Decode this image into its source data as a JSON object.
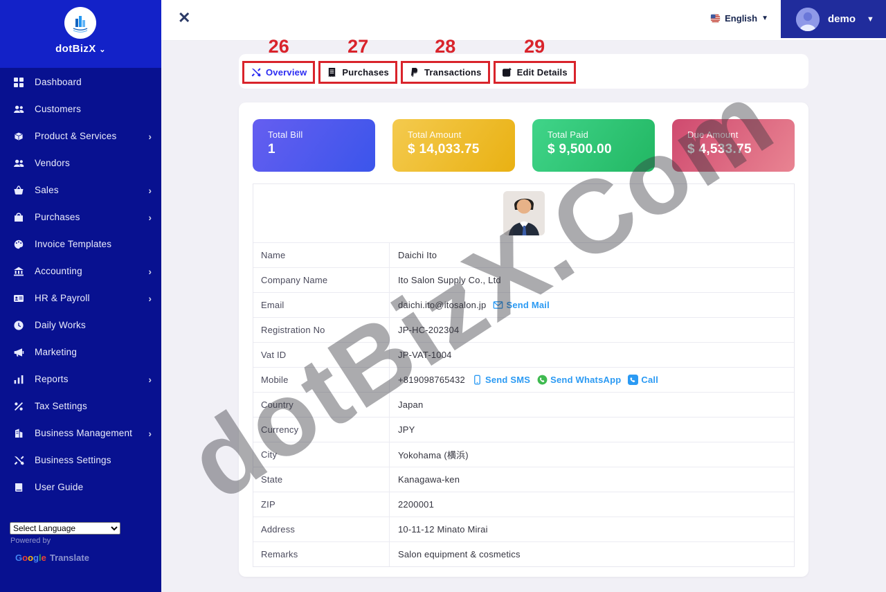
{
  "sidebar": {
    "brand": "dotBizX",
    "items": [
      {
        "label": "Dashboard",
        "icon": "grid",
        "expandable": false
      },
      {
        "label": "Customers",
        "icon": "users",
        "expandable": false
      },
      {
        "label": "Product & Services",
        "icon": "box",
        "expandable": true
      },
      {
        "label": "Vendors",
        "icon": "users",
        "expandable": false
      },
      {
        "label": "Sales",
        "icon": "cart",
        "expandable": true
      },
      {
        "label": "Purchases",
        "icon": "bag",
        "expandable": true
      },
      {
        "label": "Invoice Templates",
        "icon": "palette",
        "expandable": false
      },
      {
        "label": "Accounting",
        "icon": "bank",
        "expandable": true
      },
      {
        "label": "HR & Payroll",
        "icon": "idcard",
        "expandable": true
      },
      {
        "label": "Daily Works",
        "icon": "clock",
        "expandable": false
      },
      {
        "label": "Marketing",
        "icon": "megaphone",
        "expandable": false
      },
      {
        "label": "Reports",
        "icon": "chart",
        "expandable": true
      },
      {
        "label": "Tax Settings",
        "icon": "percent",
        "expandable": false
      },
      {
        "label": "Business Management",
        "icon": "building",
        "expandable": true
      },
      {
        "label": "Business Settings",
        "icon": "tools",
        "expandable": false
      },
      {
        "label": "User Guide",
        "icon": "book",
        "expandable": false
      }
    ],
    "language_select": "Select Language",
    "powered_by": "Powered by",
    "google_translate": "Translate"
  },
  "topbar": {
    "close": "✕",
    "language": "English",
    "user": "demo"
  },
  "tabs": [
    {
      "number": "26",
      "label": "Overview",
      "icon": "tools",
      "active": true
    },
    {
      "number": "27",
      "label": "Purchases",
      "icon": "receipt",
      "active": false
    },
    {
      "number": "28",
      "label": "Transactions",
      "icon": "paypal",
      "active": false
    },
    {
      "number": "29",
      "label": "Edit Details",
      "icon": "edit",
      "active": false
    }
  ],
  "stats": [
    {
      "label": "Total Bill",
      "value": "1",
      "from": "#655ef0",
      "to": "#3b55eb"
    },
    {
      "label": "Total Amount",
      "value": "$ 14,033.75",
      "from": "#f4ca4e",
      "to": "#e9b113"
    },
    {
      "label": "Total Paid",
      "value": "$ 9,500.00",
      "from": "#40d489",
      "to": "#22b763"
    },
    {
      "label": "Due Amount",
      "value": "$ 4,533.75",
      "from": "#cf4a6f",
      "to": "#e98492"
    }
  ],
  "details": {
    "rows": [
      {
        "label": "Name",
        "value": "Daichi Ito",
        "links": []
      },
      {
        "label": "Company Name",
        "value": "Ito Salon Supply Co., Ltd",
        "links": []
      },
      {
        "label": "Email",
        "value": "daichi.ito@itosalon.jp",
        "links": [
          {
            "icon": "mail",
            "label": "Send Mail"
          }
        ]
      },
      {
        "label": "Registration No",
        "value": "JP-HC-202304",
        "links": []
      },
      {
        "label": "Vat ID",
        "value": "JP-VAT-1004",
        "links": []
      },
      {
        "label": "Mobile",
        "value": "+819098765432",
        "links": [
          {
            "icon": "sms",
            "label": "Send SMS"
          },
          {
            "icon": "whatsapp",
            "label": "Send WhatsApp"
          },
          {
            "icon": "call",
            "label": "Call"
          }
        ]
      },
      {
        "label": "Country",
        "value": "Japan",
        "links": []
      },
      {
        "label": "Currency",
        "value": "JPY",
        "links": []
      },
      {
        "label": "City",
        "value": "Yokohama (横浜)",
        "links": []
      },
      {
        "label": "State",
        "value": "Kanagawa-ken",
        "links": []
      },
      {
        "label": "ZIP",
        "value": "2200001",
        "links": []
      },
      {
        "label": "Address",
        "value": "10-11-12 Minato Mirai",
        "links": []
      },
      {
        "label": "Remarks",
        "value": "Salon equipment & cosmetics",
        "links": []
      }
    ]
  },
  "watermark": "dotBizX.Com",
  "colors": {
    "annotation_red": "#d9232b",
    "link_blue": "#2b9af3",
    "active_tab_blue": "#2b2bf2",
    "sidebar_navy": "#081190",
    "sidebar_header_blue": "#1322c8",
    "user_block_blue": "#202c9c"
  }
}
